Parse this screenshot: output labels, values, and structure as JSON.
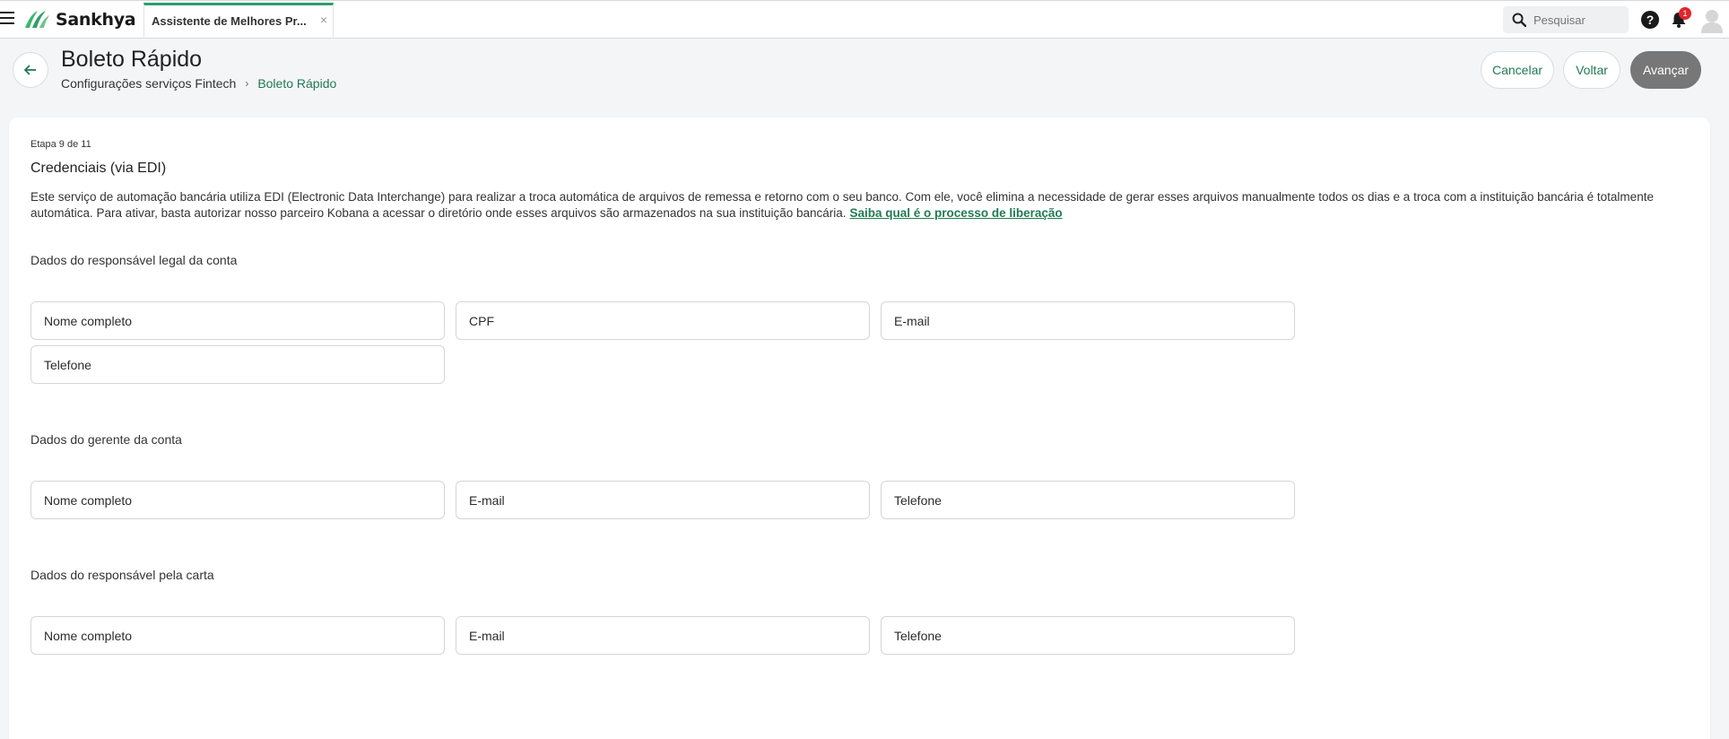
{
  "app": {
    "brand": "Sankhya",
    "tab_label": "Assistente de Melhores Pr...",
    "tab_close": "×",
    "search_placeholder": "Pesquisar",
    "help": "?",
    "notifications_count": "1"
  },
  "header": {
    "title": "Boleto Rápido",
    "breadcrumb": {
      "parent": "Configurações serviços Fintech",
      "separator": "›",
      "current": "Boleto Rápido"
    },
    "buttons": {
      "cancel": "Cancelar",
      "back": "Voltar",
      "next": "Avançar"
    }
  },
  "step": {
    "label": "Etapa 9 de 11",
    "title": "Credenciais (via EDI)",
    "description": "Este serviço de automação bancária utiliza EDI (Electronic Data Interchange) para realizar a troca automática de arquivos de remessa e retorno com o seu banco. Com ele, você elimina a necessidade de gerar esses arquivos manualmente todos os dias e a troca com a instituição bancária é totalmente automática. Para ativar, basta autorizar nosso parceiro Kobana a acessar o diretório onde esses arquivos são armazenados na sua instituição bancária.",
    "link": "Saiba qual é o processo de liberação"
  },
  "sections": {
    "legal": {
      "title": "Dados do responsável legal da conta",
      "fields": [
        "Nome completo",
        "CPF",
        "E-mail",
        "Telefone"
      ]
    },
    "manager": {
      "title": "Dados do gerente da conta",
      "fields": [
        "Nome completo",
        "E-mail",
        "Telefone"
      ]
    },
    "letter": {
      "title": "Dados do responsável pela carta",
      "fields": [
        "Nome completo",
        "E-mail",
        "Telefone"
      ]
    }
  },
  "colors": {
    "accent": "#217a55",
    "tab_accent": "#2e9d6a",
    "primary_disabled": "#777777",
    "badge": "#e0262b"
  }
}
